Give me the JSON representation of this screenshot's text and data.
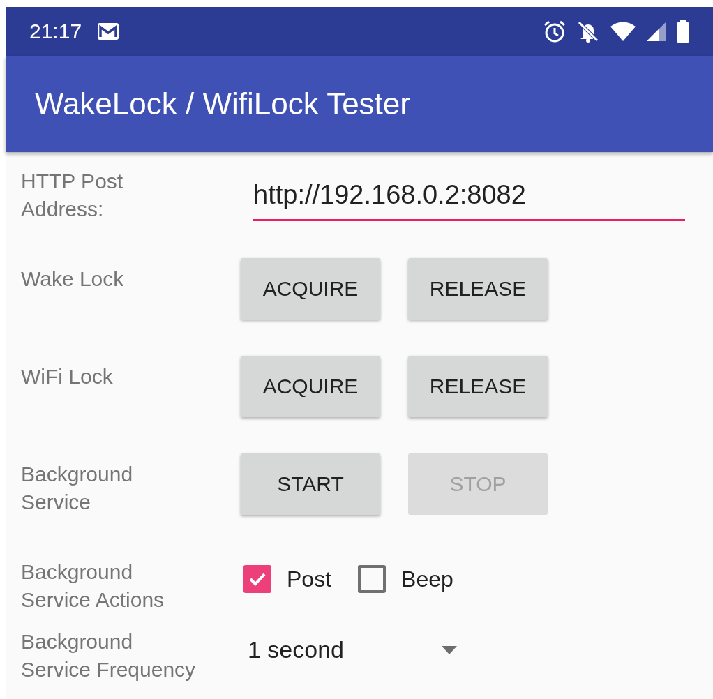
{
  "status_bar": {
    "time": "21:17"
  },
  "app_bar": {
    "title": "WakeLock / WifiLock Tester"
  },
  "rows": [
    {
      "kind": "field",
      "label": "HTTP Post\nAddress:",
      "value": "http://192.168.0.2:8082"
    },
    {
      "kind": "buttons",
      "label": "Wake Lock",
      "buttons": [
        {
          "label": "ACQUIRE",
          "disabled": false
        },
        {
          "label": "RELEASE",
          "disabled": false
        }
      ]
    },
    {
      "kind": "buttons",
      "label": "WiFi Lock",
      "buttons": [
        {
          "label": "ACQUIRE",
          "disabled": false
        },
        {
          "label": "RELEASE",
          "disabled": false
        }
      ]
    },
    {
      "kind": "buttons",
      "label": "Background\nService",
      "buttons": [
        {
          "label": "START",
          "disabled": false
        },
        {
          "label": "STOP",
          "disabled": true
        }
      ]
    },
    {
      "kind": "checks",
      "label": "Background\nService Actions",
      "checks": [
        {
          "label": "Post",
          "checked": true
        },
        {
          "label": "Beep",
          "checked": false
        }
      ]
    },
    {
      "kind": "dropdown",
      "label": "Background\nService Frequency",
      "value": "1 second"
    }
  ]
}
